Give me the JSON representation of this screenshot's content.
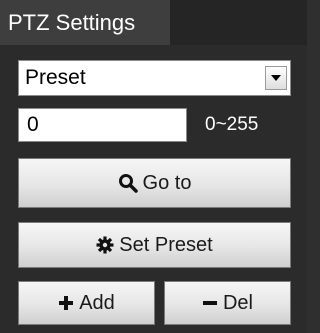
{
  "panel": {
    "tab_title": "PTZ Settings"
  },
  "preset_select": {
    "selected": "Preset",
    "options": [
      "Preset"
    ]
  },
  "preset_input": {
    "value": "0"
  },
  "range_label": "0~255",
  "buttons": {
    "goto_label": "Go to",
    "set_preset_label": "Set Preset",
    "add_label": "Add",
    "del_label": "Del"
  },
  "icons": {
    "goto": "search-icon",
    "set_preset": "gear-icon",
    "add": "plus-icon",
    "del": "minus-icon",
    "dropdown": "chevron-down-icon"
  },
  "colors": {
    "panel_bg": "#2b2b2b",
    "tab_bg": "#3e3e3e",
    "text_light": "#ffffff"
  }
}
